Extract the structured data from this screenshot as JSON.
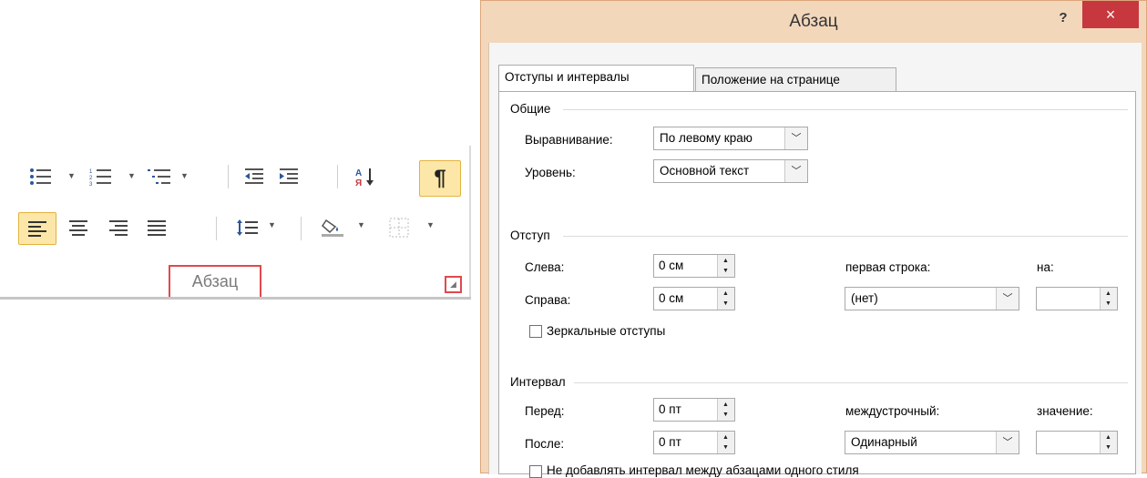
{
  "ribbon": {
    "group_label": "Абзац",
    "icons_row1": [
      "bullets-icon",
      "numbering-icon",
      "multilevel-list-icon",
      "decrease-indent-icon",
      "increase-indent-icon",
      "sort-icon",
      "show-formatting-icon"
    ],
    "icons_row2": [
      "align-left-icon",
      "align-center-icon",
      "align-right-icon",
      "justify-icon",
      "line-spacing-icon",
      "shading-icon",
      "borders-icon"
    ],
    "active_color": "#fde7a8",
    "highlight_color": "#e0494d"
  },
  "dialog": {
    "title": "Абзац",
    "help": "?",
    "close": "×",
    "tabs": [
      "Отступы и интервалы",
      "Положение на странице"
    ],
    "sections": {
      "general": {
        "heading": "Общие",
        "alignment_label": "Выравнивание:",
        "alignment_value": "По левому краю",
        "level_label": "Уровень:",
        "level_value": "Основной текст"
      },
      "indent": {
        "heading": "Отступ",
        "left_label": "Слева:",
        "left_value": "0 см",
        "right_label": "Справа:",
        "right_value": "0 см",
        "first_line_label": "первая строка:",
        "first_line_value": "(нет)",
        "by_label": "на:",
        "by_value": "",
        "mirror_label": "Зеркальные отступы"
      },
      "spacing": {
        "heading": "Интервал",
        "before_label": "Перед:",
        "before_value": "0 пт",
        "after_label": "После:",
        "after_value": "0 пт",
        "line_spacing_label": "междустрочный:",
        "line_spacing_value": "Одинарный",
        "at_label": "значение:",
        "at_value": "",
        "no_space_label": "Не добавлять интервал между абзацами одного стиля"
      }
    },
    "colors": {
      "frame": "#f3d7bb",
      "close_bg": "#c7383e"
    }
  }
}
